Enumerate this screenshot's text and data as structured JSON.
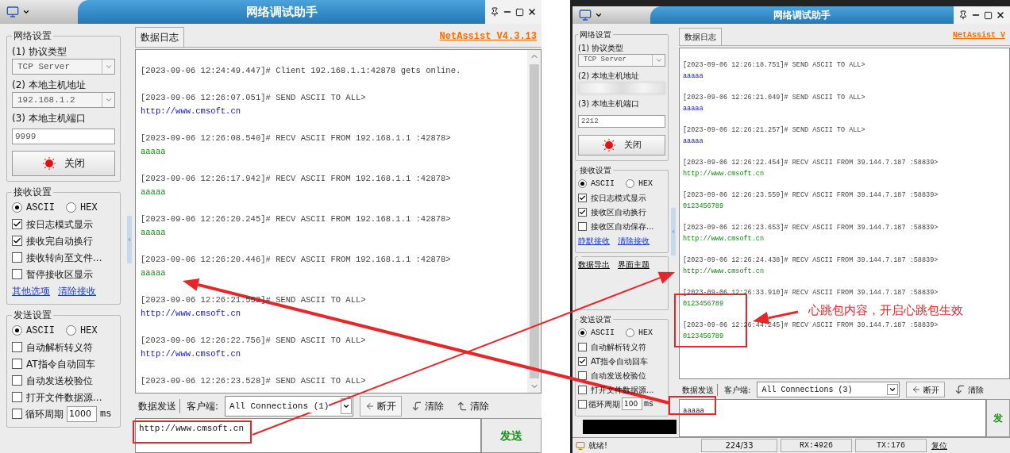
{
  "windows": [
    {
      "title": "网络调试助手",
      "network_settings": {
        "heading": "网络设置",
        "protocol_label": "(1) 协议类型",
        "protocol": "TCP Server",
        "host_label": "(2) 本地主机地址",
        "host": "192.168.1.2",
        "port_label": "(3) 本地主机端口",
        "port": "9999",
        "connect_button": "关闭"
      },
      "receive_settings": {
        "heading": "接收设置",
        "modes": [
          {
            "label": "ASCII",
            "selected": true
          },
          {
            "label": "HEX",
            "selected": false
          }
        ],
        "options": [
          {
            "label": "按日志模式显示",
            "checked": true
          },
          {
            "label": "接收完自动换行",
            "checked": true
          },
          {
            "label": "接收转向至文件...",
            "checked": false
          },
          {
            "label": "暂停接收区显示",
            "checked": false
          }
        ],
        "links": [
          "其他选项",
          "清除接收"
        ]
      },
      "send_settings": {
        "heading": "发送设置",
        "modes": [
          {
            "label": "ASCII",
            "selected": true
          },
          {
            "label": "HEX",
            "selected": false
          }
        ],
        "options": [
          {
            "label": "自动解析转义符",
            "checked": false
          },
          {
            "label": "AT指令自动回车",
            "checked": false
          },
          {
            "label": "自动发送校验位",
            "checked": false
          },
          {
            "label": "打开文件数据源...",
            "checked": false
          }
        ],
        "cycle": {
          "label": "循环周期",
          "checked": false,
          "value": "1000",
          "unit": "ms"
        }
      },
      "log_tab": "数据日志",
      "version": "NetAssist V4.3.13",
      "log": [
        {
          "kind": "info",
          "header": "[2023-09-06 12:24:49.447]# Client 192.168.1.1:42878 gets online."
        },
        {
          "kind": "send",
          "header": "[2023-09-06 12:26:07.051]# SEND ASCII TO ALL>",
          "body": "http://www.cmsoft.cn"
        },
        {
          "kind": "recv",
          "header": "[2023-09-06 12:26:08.540]# RECV ASCII FROM 192.168.1.1 :42878>",
          "body": "aaaaa"
        },
        {
          "kind": "recv",
          "header": "[2023-09-06 12:26:17.942]# RECV ASCII FROM 192.168.1.1 :42878>",
          "body": "aaaaa"
        },
        {
          "kind": "recv",
          "header": "[2023-09-06 12:26:20.245]# RECV ASCII FROM 192.168.1.1 :42878>",
          "body": "aaaaa"
        },
        {
          "kind": "recv",
          "header": "[2023-09-06 12:26:20.446]# RECV ASCII FROM 192.168.1.1 :42878>",
          "body": "aaaaa"
        },
        {
          "kind": "send",
          "header": "[2023-09-06 12:26:21.552]# SEND ASCII TO ALL>",
          "body": "http://www.cmsoft.cn"
        },
        {
          "kind": "send",
          "header": "[2023-09-06 12:26:22.756]# SEND ASCII TO ALL>",
          "body": "http://www.cmsoft.cn"
        },
        {
          "kind": "send",
          "header": "[2023-09-06 12:26:23.528]# SEND ASCII TO ALL>"
        }
      ],
      "send_tab": "数据发送",
      "client_label": "客户端:",
      "client": "All Connections (1)",
      "disconnect_button": "断开",
      "clear_buttons": [
        "清除",
        "清除"
      ],
      "send_input": "http://www.cmsoft.cn",
      "send_button": "发送"
    },
    {
      "title": "网络调试助手",
      "network_settings": {
        "heading": "网络设置",
        "protocol_label": "(1) 协议类型",
        "protocol": "TCP Server",
        "host_label": "(2) 本地主机地址",
        "host_blurred": true,
        "port_label": "(3) 本地主机端口",
        "port": "2212",
        "connect_button": "关闭"
      },
      "receive_settings": {
        "heading": "接收设置",
        "modes": [
          {
            "label": "ASCII",
            "selected": true
          },
          {
            "label": "HEX",
            "selected": false
          }
        ],
        "options": [
          {
            "label": "按日志模式显示",
            "checked": true
          },
          {
            "label": "接收区自动换行",
            "checked": true
          },
          {
            "label": "接收区自动保存...",
            "checked": false
          }
        ],
        "links": [
          "静默接收",
          "清除接收"
        ]
      },
      "extra_links": [
        "数据导出",
        "界面主题"
      ],
      "send_settings": {
        "heading": "发送设置",
        "modes": [
          {
            "label": "ASCII",
            "selected": true
          },
          {
            "label": "HEX",
            "selected": false
          }
        ],
        "options": [
          {
            "label": "自动解析转义符",
            "checked": false
          },
          {
            "label": "AT指令自动回车",
            "checked": true
          },
          {
            "label": "自动发送校验位",
            "checked": false
          },
          {
            "label": "打开文件数据源...",
            "checked": false
          }
        ],
        "cycle": {
          "label": "循环周期",
          "checked": false,
          "value": "100",
          "unit": "ms"
        }
      },
      "redacted": true,
      "log_tab": "数据日志",
      "version": "NetAssist V",
      "log": [
        {
          "kind": "send",
          "header": "[2023-09-06 12:26:18.751]# SEND ASCII TO ALL>",
          "body": "aaaaa"
        },
        {
          "kind": "send",
          "header": "[2023-09-06 12:26:21.049]# SEND ASCII TO ALL>",
          "body": "aaaaa"
        },
        {
          "kind": "send",
          "header": "[2023-09-06 12:26:21.257]# SEND ASCII TO ALL>",
          "body": "aaaaa"
        },
        {
          "kind": "recv",
          "header": "[2023-09-06 12:26:22.454]# RECV ASCII FROM 39.144.7.187 :58839>",
          "body": "http://www.cmsoft.cn"
        },
        {
          "kind": "recv",
          "header": "[2023-09-06 12:26:23.559]# RECV ASCII FROM 39.144.7.187 :58839>",
          "body": "0123456789"
        },
        {
          "kind": "recv",
          "header": "[2023-09-06 12:26:23.653]# RECV ASCII FROM 39.144.7.187 :58839>",
          "body": "http://www.cmsoft.cn"
        },
        {
          "kind": "recv",
          "header": "[2023-09-06 12:26:24.438]# RECV ASCII FROM 39.144.7.187 :58839>",
          "body": "http://www.cmsoft.cn"
        },
        {
          "kind": "recv",
          "header": "[2023-09-06 12:26:33.910]# RECV ASCII FROM 39.144.7.187 :58839>",
          "body": "0123456789"
        },
        {
          "kind": "recv",
          "header": "[2023-09-06 12:26:44.245]# RECV ASCII FROM 39.144.7.187 :58839>",
          "body": "0123456789"
        }
      ],
      "send_tab": "数据发送",
      "client_label": "客户端:",
      "client": "All Connections (3)",
      "disconnect_button": "断开",
      "clear_buttons": [
        "清除"
      ],
      "send_input": "aaaaa",
      "send_button": "发",
      "status_bar": {
        "message": "就绪!",
        "counts": "224/33",
        "rx": "RX:4926",
        "tx": "TX:176",
        "reset_button": "复位"
      }
    }
  ],
  "annotation": {
    "note": "心跳包内容，开启心跳包生效"
  }
}
